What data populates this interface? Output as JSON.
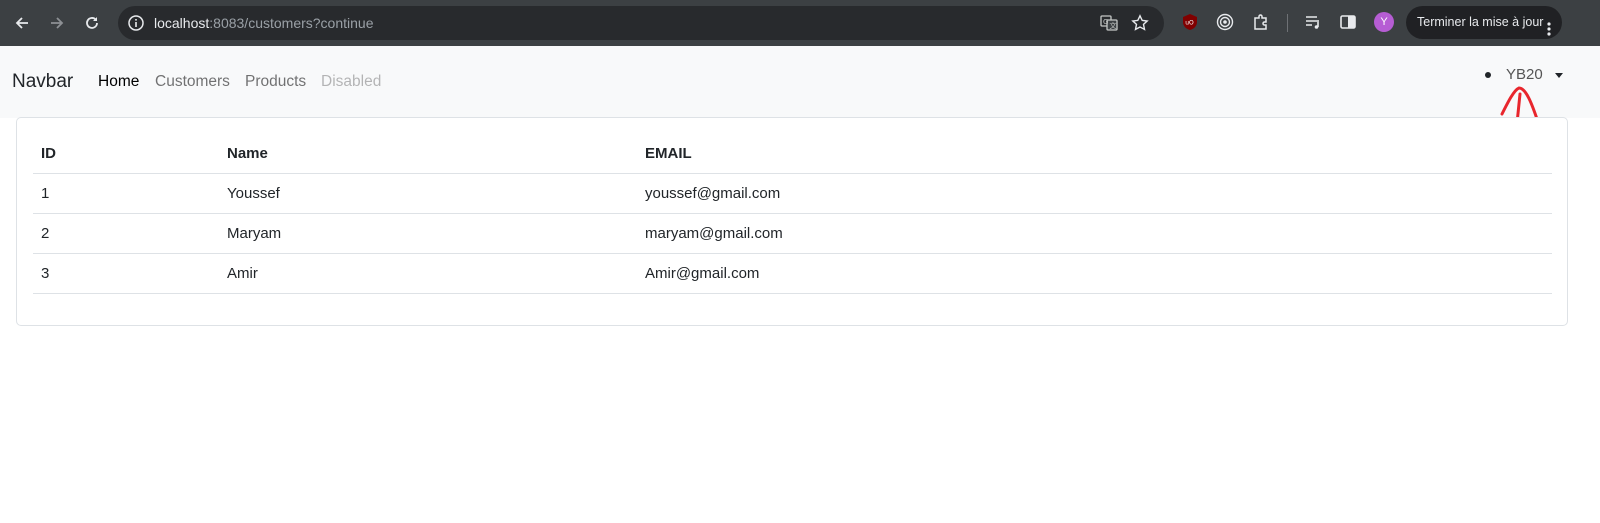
{
  "browser": {
    "url_host": "localhost",
    "url_rest": ":8083/customers?continue",
    "profile_initial": "Y",
    "update_button": "Terminer la mise à jour",
    "icons": [
      "back-icon",
      "forward-icon",
      "reload-icon",
      "site-info-icon",
      "translate-icon",
      "bookmark-star-icon",
      "ublock-icon",
      "extension-target-icon",
      "extensions-puzzle-icon",
      "reading-list-icon",
      "side-panel-icon",
      "kebab-menu-icon"
    ]
  },
  "navbar": {
    "brand": "Navbar",
    "links": [
      {
        "label": "Home",
        "state": "active"
      },
      {
        "label": "Customers",
        "state": "normal"
      },
      {
        "label": "Products",
        "state": "normal"
      },
      {
        "label": "Disabled",
        "state": "disabled"
      }
    ],
    "user": "YB20"
  },
  "table": {
    "headers": [
      "ID",
      "Name",
      "EMAIL"
    ],
    "rows": [
      [
        "1",
        "Youssef",
        "youssef@gmail.com"
      ],
      [
        "2",
        "Maryam",
        "maryam@gmail.com"
      ],
      [
        "3",
        "Amir",
        "Amir@gmail.com"
      ]
    ]
  },
  "colors": {
    "chrome_bg": "#3c4043",
    "omnibox_bg": "#282a2d",
    "navbar_bg": "#f8f9fa",
    "annotation": "#e8262d"
  }
}
